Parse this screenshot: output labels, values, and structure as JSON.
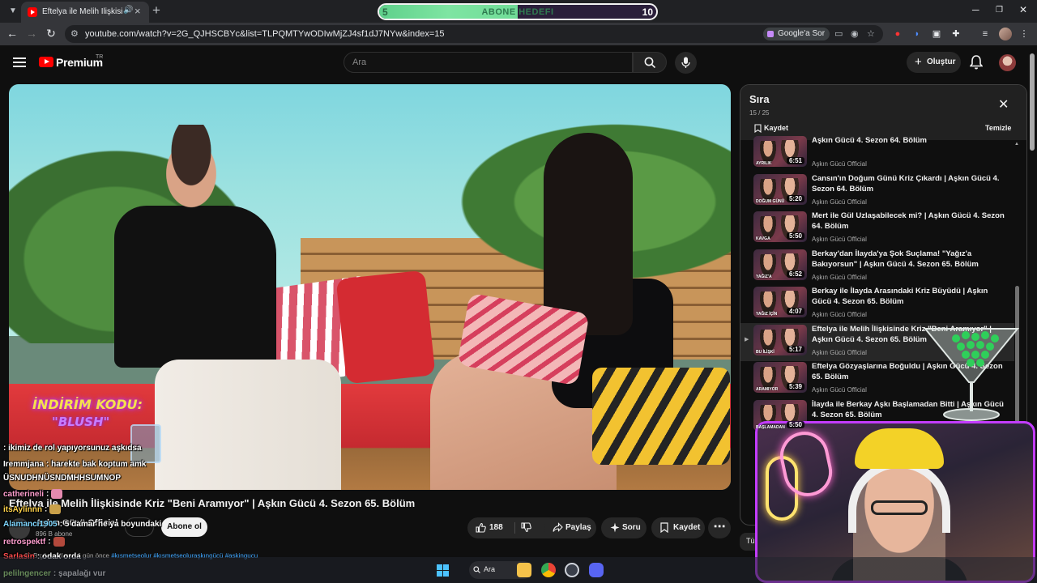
{
  "browser": {
    "tab_title": "Eftelya ile Melih İlişkisinde K",
    "url": "youtube.com/watch?v=2G_QJHSCBYc&list=TLPQMTYwODIwMjZJ4sf1dJ7NYw&index=15",
    "google_ask_label": "Google'a Sor"
  },
  "sub_goal": {
    "start": "5",
    "label": "ABONE HEDEFI",
    "end": "10",
    "progress_fraction": 0.5
  },
  "youtube": {
    "brand": "Premium",
    "region": "TR",
    "search_placeholder": "Ara",
    "create_label": "Oluştur"
  },
  "video": {
    "promo_line1": "İNDİRİM KODU:",
    "promo_line2": "\"BLUSH\"",
    "title": "Eftelya ile Melih İlişkisinde Kriz \"Beni Aramıyor\" | Aşkın Gücü 4. Sezon 65. Bölüm",
    "channel": "Aşkın Gücü Official",
    "subscribers": "896 B abone",
    "subscribe_label": "Abone ol",
    "likes": "188",
    "share_label": "Paylaş",
    "ask_label": "Soru",
    "save_label": "Kaydet",
    "meta_prefix": "31 B görüntüleme  6 gün önce  ",
    "meta_tags": "#kısmetseolur #kısmetseolurаşkıngücü #askingucu"
  },
  "queue": {
    "title": "Sıra",
    "position": "15 / 25",
    "save_label": "Kaydet",
    "clear_label": "Temizle",
    "items": [
      {
        "title": "Aşkın Gücü 4. Sezon 64. Bölüm",
        "channel": "Aşkın Gücü Official",
        "duration": "6:51",
        "thumb_label": "AYRILIK",
        "active": false
      },
      {
        "title": "Cansın'ın Doğum Günü Kriz Çıkardı | Aşkın Gücü 4. Sezon 64. Bölüm",
        "channel": "Aşkın Gücü Official",
        "duration": "5:20",
        "thumb_label": "DOĞUM GÜNÜ",
        "active": false
      },
      {
        "title": "Mert ile Gül Uzlaşabilecek mi? | Aşkın Gücü 4. Sezon 64. Bölüm",
        "channel": "Aşkın Gücü Official",
        "duration": "5:50",
        "thumb_label": "KAVGA",
        "active": false
      },
      {
        "title": "Berkay'dan İlayda'ya Şok Suçlama! \"Yağız'a Bakıyorsun\" | Aşkın Gücü 4. Sezon 65. Bölüm",
        "channel": "Aşkın Gücü Official",
        "duration": "6:52",
        "thumb_label": "YAĞIZ'A",
        "active": false
      },
      {
        "title": "Berkay ile İlayda Arasındaki Kriz Büyüdü | Aşkın Gücü 4. Sezon 65. Bölüm",
        "channel": "Aşkın Gücü Official",
        "duration": "4:07",
        "thumb_label": "YAĞIZ İÇİN",
        "active": false
      },
      {
        "title": "Eftelya ile Melih İlişkisinde Kriz \"Beni Aramıyor\" | Aşkın Gücü 4. Sezon 65. Bölüm",
        "channel": "Aşkın Gücü Official",
        "duration": "5:17",
        "thumb_label": "BU İLİŞKİ",
        "active": true
      },
      {
        "title": "Eftelya Gözyaşlarına Boğuldu | Aşkın Gücü 4. Sezon 65. Bölüm",
        "channel": "Aşkın Gücü Official",
        "duration": "5:39",
        "thumb_label": "ARAMIYOR",
        "active": false
      },
      {
        "title": "İlayda ile Berkay Aşkı Başlamadan Bitti | Aşkın Gücü 4. Sezon 65. Bölüm",
        "channel": "Aşkın Gücü Official",
        "duration": "5:50",
        "thumb_label": "BAŞLAMADAN",
        "active": false
      }
    ]
  },
  "side_button": "Tü",
  "chat": [
    {
      "user": "",
      "message": ": ikimiz de rol yapıyorsunuz aşkıdsa",
      "emote": ""
    },
    {
      "user": "Iremmjana",
      "message": ": harekte bak koptum amk",
      "emote": ""
    },
    {
      "user": "",
      "message": "ÜSNUDHNÜSNDMHHSUMNOP",
      "emote": ""
    },
    {
      "user": "catherineli",
      "message": ":",
      "emote": "pink"
    },
    {
      "user": "itsAylinnn",
      "message": ":",
      "emote": "gold"
    },
    {
      "user": "Alamanci1905",
      "message": ": 5 damar ne ya boyundaki",
      "emote": ""
    },
    {
      "user": "retrospektf",
      "message": ":",
      "emote": "red"
    },
    {
      "user": "Sarlasin",
      "message": ": odak orda",
      "emote": ""
    },
    {
      "user": "pelilngencer",
      "message": ": şapalağı vur",
      "emote": ""
    }
  ],
  "taskbar": {
    "search_label": "Ara"
  },
  "colors": {
    "accent": "#ff0000",
    "webcam_border": "#c33cff",
    "subgoal_fill": "#6fdc97",
    "link": "#3ea6ff"
  }
}
